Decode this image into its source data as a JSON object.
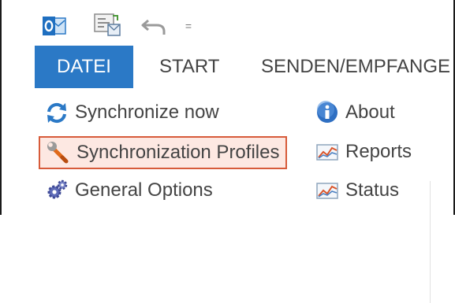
{
  "quick_access": {
    "icons": [
      "outlook-icon",
      "send-receive-icon",
      "undo-icon",
      "customize-dropdown-icon"
    ],
    "more_glyph": "="
  },
  "tabs": [
    {
      "label": "DATEI",
      "active": true
    },
    {
      "label": "START",
      "active": false
    },
    {
      "label": "SENDEN/EMPFANGE",
      "active": false
    }
  ],
  "ribbon": {
    "commands_left": [
      {
        "label": "Synchronize now",
        "icon": "sync-arrows-icon"
      },
      {
        "label": "Synchronization Profiles",
        "icon": "wrench-icon",
        "highlighted": true
      },
      {
        "label": "General Options",
        "icon": "gears-icon"
      }
    ],
    "commands_right": [
      {
        "label": "About",
        "icon": "info-icon"
      },
      {
        "label": "Reports",
        "icon": "chart-icon"
      },
      {
        "label": "Status",
        "icon": "chart-icon"
      }
    ]
  },
  "colors": {
    "active_tab": "#2b79c6",
    "highlight_border": "#d75b3a",
    "highlight_fill": "#fde8e2"
  }
}
